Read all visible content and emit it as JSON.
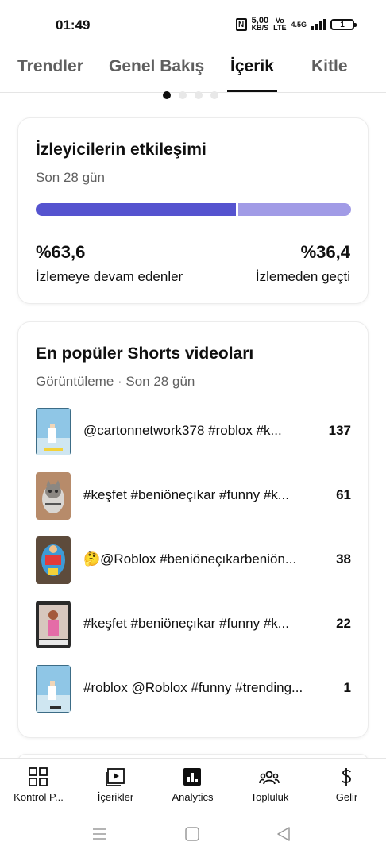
{
  "status": {
    "time": "01:49",
    "nfc": "N",
    "speed_value": "5,00",
    "speed_unit": "KB/S",
    "volte_top": "Vo",
    "volte_bottom": "LTE",
    "network": "4.5G",
    "battery": "1"
  },
  "tabs": [
    {
      "label": "Trendler"
    },
    {
      "label": "Genel Bakış"
    },
    {
      "label": "İçerik"
    },
    {
      "label": "Kitle"
    }
  ],
  "engagement": {
    "title": "İzleyicilerin etkileşimi",
    "subtitle": "Son 28 gün",
    "continued_share": 0.636,
    "continued_color": "#5553cf",
    "skipped_color": "#a19be6",
    "left_value": "%63,6",
    "left_label": "İzlemeye devam edenler",
    "right_value": "%36,4",
    "right_label": "İzlemeden geçti"
  },
  "popular": {
    "title": "En popüler Shorts videoları",
    "subtitle": "Görüntüleme · Son 28 gün",
    "videos": [
      {
        "title": "@cartonnetwork378 #roblox #k...",
        "views": "137"
      },
      {
        "title": "#keşfet #beniöneçıkar #funny #k...",
        "views": "61"
      },
      {
        "title": "🤔@Roblox #beniöneçıkarbeniön...",
        "views": "38"
      },
      {
        "title": "#keşfet #beniöneçıkar #funny #k...",
        "views": "22"
      },
      {
        "title": "#roblox @Roblox #funny #trending...",
        "views": "1"
      }
    ]
  },
  "bottom_nav": [
    {
      "label": "Kontrol P...",
      "icon": "dashboard-icon"
    },
    {
      "label": "İçerikler",
      "icon": "content-icon"
    },
    {
      "label": "Analytics",
      "icon": "analytics-icon"
    },
    {
      "label": "Topluluk",
      "icon": "community-icon"
    },
    {
      "label": "Gelir",
      "icon": "earn-icon"
    }
  ]
}
